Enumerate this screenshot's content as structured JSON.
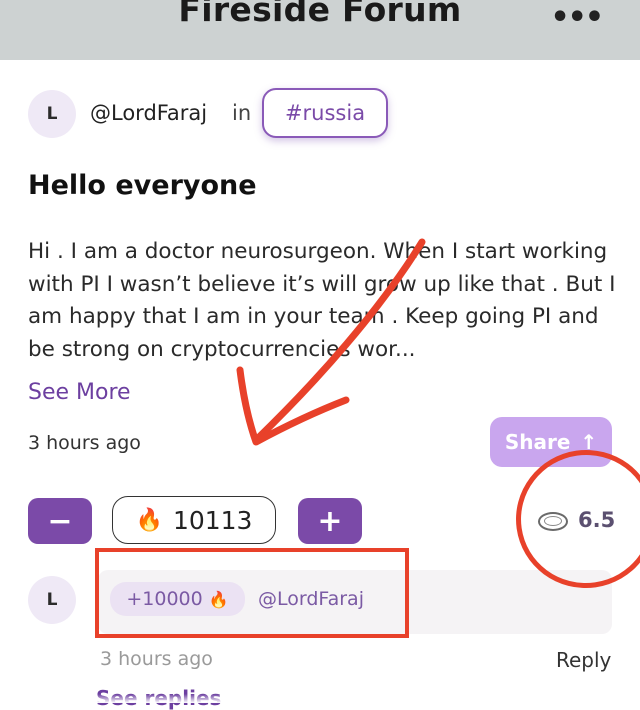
{
  "header": {
    "title": "Fireside Forum",
    "more_label": "•••"
  },
  "post": {
    "avatar_initial": "L",
    "author": "@LordFaraj",
    "in_label": "in",
    "channel": "#russia",
    "title": "Hello everyone",
    "body": "Hi . I am a doctor neurosurgeon. When I start working with PI I wasn’t believe it’s will grow up like that . But I am happy that I am in your team . Keep going PI and be strong on cryptocurrencies wor...",
    "see_more": "See More",
    "time": "3 hours ago",
    "share_label": "Share",
    "share_icon": "↑",
    "vote_count": "10113",
    "fire_icon": "🔥",
    "coin_value": "6.5",
    "minus_label": "−",
    "plus_label": "+"
  },
  "comment": {
    "avatar_initial": "L",
    "tip_amount": "+10000",
    "author": "@LordFaraj",
    "time": "3 hours ago",
    "reply_label": "Reply",
    "see_replies": "See replies"
  },
  "annotation_colors": {
    "markup": "#e8412a",
    "accent": "#7b4aa8"
  }
}
